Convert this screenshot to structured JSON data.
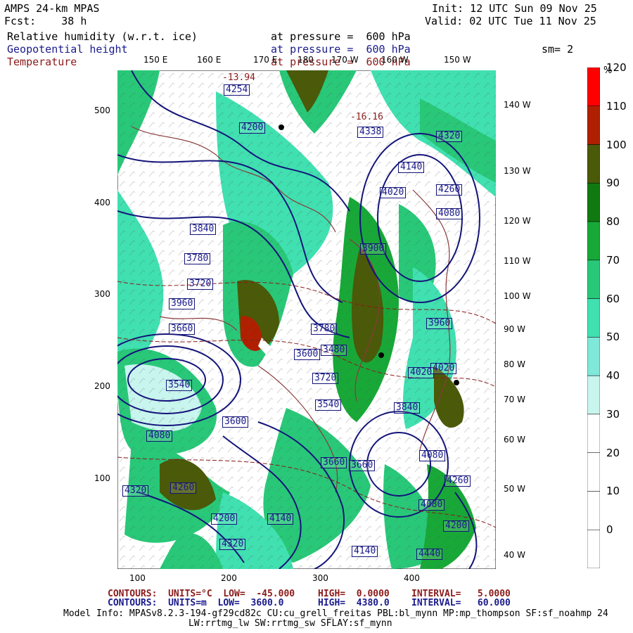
{
  "header": {
    "model": "AMPS 24-km MPAS",
    "fcst": "Fcst:    38 h",
    "init": "Init: 12 UTC Sun 09 Nov 25",
    "valid": "Valid: 02 UTC Tue 11 Nov 25",
    "fields": [
      {
        "name": "Relative humidity (w.r.t. ice)",
        "level": "at pressure =  600 hPa",
        "color": "#000000"
      },
      {
        "name": "Geopotential height",
        "level": "at pressure =  600 hPa",
        "color": "#1a1a8c"
      },
      {
        "name": "Temperature",
        "level": "at pressure =  600 hPa",
        "color": "#8b1a1a"
      }
    ],
    "smooth": "sm= 2"
  },
  "colorbar": {
    "unit": "%",
    "colors": [
      "#ffffff",
      "#ffffff",
      "#ffffff",
      "#ffffff",
      "#c8f5ee",
      "#7fe8d8",
      "#40e0b0",
      "#28c878",
      "#18a838",
      "#107a10",
      "#4a5a08",
      "#b02000",
      "#ff0000"
    ],
    "labels": [
      "0",
      "10",
      "20",
      "30",
      "40",
      "50",
      "60",
      "70",
      "80",
      "90",
      "100",
      "110",
      "120"
    ]
  },
  "map": {
    "lon_labels_top": [
      "150 E",
      "160 E",
      "170 E",
      "180",
      "170 W",
      "160 W",
      "150 W"
    ],
    "lon_labels_right": [
      "140 W",
      "130 W",
      "120 W",
      "110 W",
      "100 W",
      "90 W",
      "80 W",
      "70 W",
      "60 W",
      "50 W",
      "40 W"
    ],
    "x_ticks": [
      "100",
      "200",
      "300",
      "400"
    ],
    "y_ticks": [
      "100",
      "200",
      "300",
      "400",
      "500"
    ],
    "height_labels": [
      "4254",
      "4200",
      "4338",
      "4320",
      "4140",
      "4260",
      "4080",
      "4020",
      "3960",
      "3840",
      "3780",
      "3720",
      "3900",
      "3660",
      "3600",
      "3540",
      "3480",
      "3660",
      "4020",
      "4080",
      "4320",
      "4260",
      "4200",
      "4140",
      "4320",
      "4140",
      "4440",
      "4200",
      "4080",
      "4260",
      "3840",
      "4080",
      "3960",
      "4020",
      "3780",
      "3720",
      "3660",
      "3600",
      "3540"
    ],
    "temp_labels": [
      "-13.94",
      "-16.16"
    ]
  },
  "footer": {
    "line1": {
      "label": "CONTOURS:  UNITS=°C  LOW=  -45.000",
      "high": "HIGH=  0.0000",
      "interval": "INTERVAL=   5.0000"
    },
    "line2": {
      "label": "CONTOURS:  UNITS=m  LOW=  3600.0",
      "high": "HIGH=  4380.0",
      "interval": "INTERVAL=   60.000"
    },
    "model_info": "Model Info: MPASv8.2.3-194-gf29cd82c CU:cu_grell_freitas PBL:bl_mynn MP:mp_thompson SF:sf_noahmp 24",
    "model_info2": "LW:rrtmg_lw SW:rrtmg_sw SFLAY:sf_mynn"
  }
}
